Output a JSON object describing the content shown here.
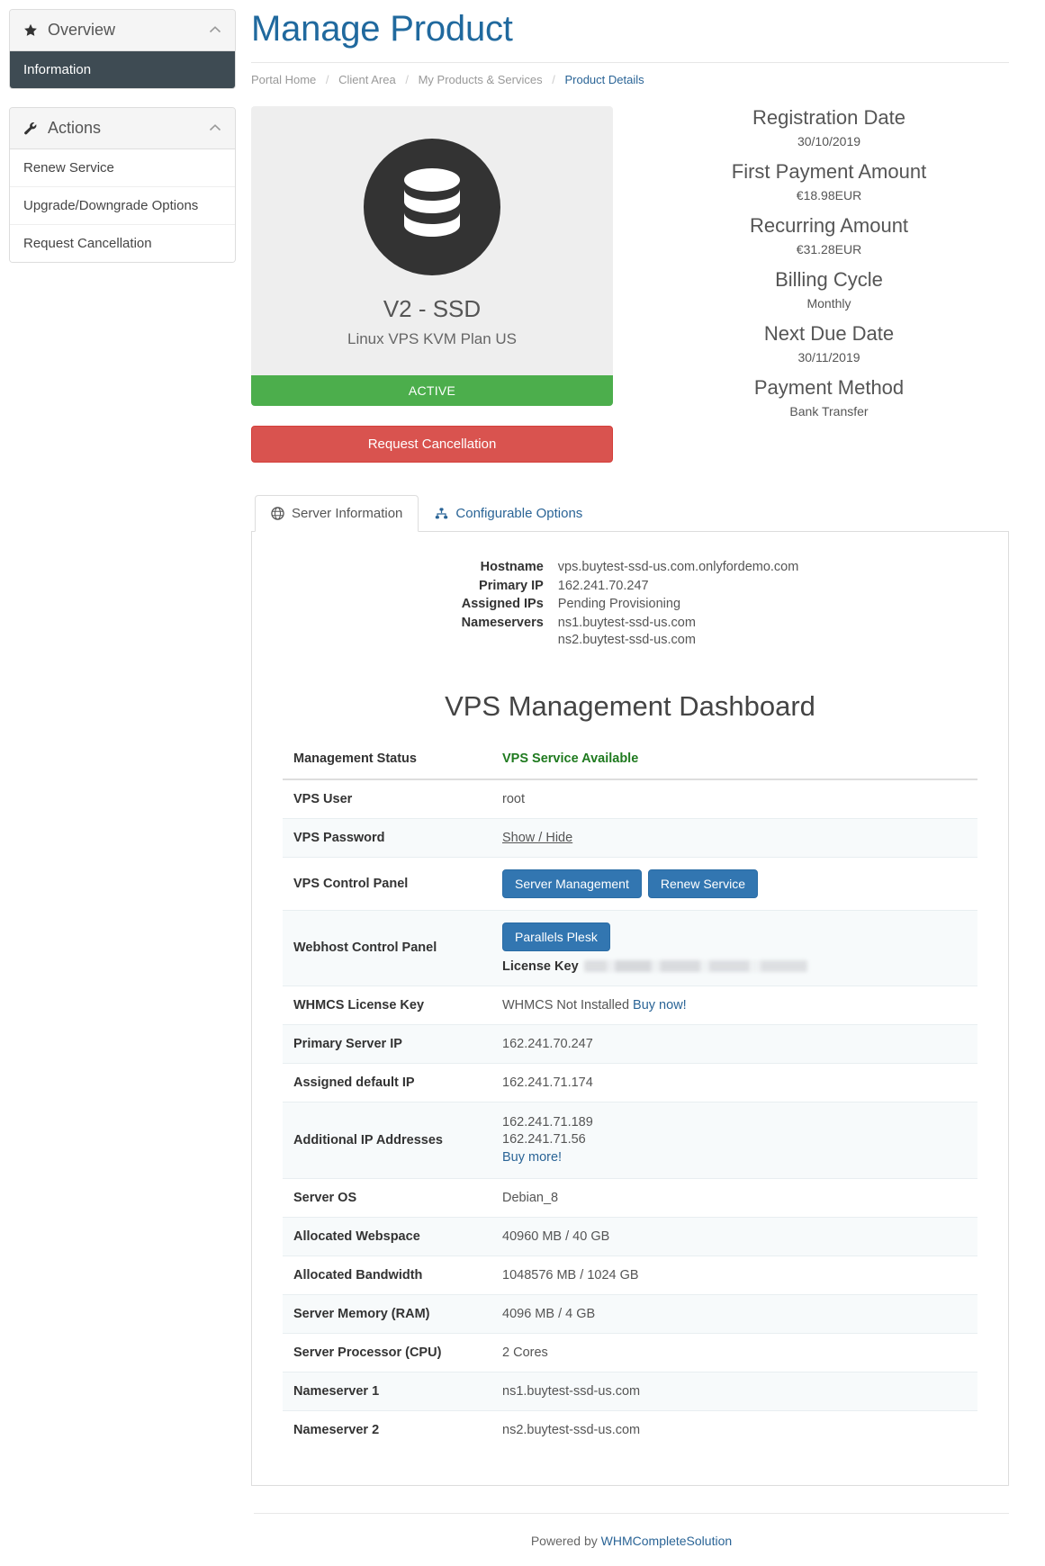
{
  "sidebar": {
    "overview_panel": {
      "title": "Overview",
      "icon": "star-icon",
      "caret": "chevron-up-icon",
      "items": [
        {
          "label": "Information",
          "active": true
        }
      ]
    },
    "actions_panel": {
      "title": "Actions",
      "icon": "wrench-icon",
      "caret": "chevron-up-icon",
      "items": [
        {
          "label": "Renew Service",
          "active": false
        },
        {
          "label": "Upgrade/Downgrade Options",
          "active": false
        },
        {
          "label": "Request Cancellation",
          "active": false
        }
      ]
    }
  },
  "header": {
    "title": "Manage Product",
    "breadcrumb": [
      {
        "label": "Portal Home",
        "current": false
      },
      {
        "label": "Client Area",
        "current": false
      },
      {
        "label": "My Products & Services",
        "current": false
      },
      {
        "label": "Product Details",
        "current": true
      }
    ],
    "separator": "/"
  },
  "product": {
    "icon": "database-icon",
    "name": "V2 - SSD",
    "description": "Linux VPS KVM Plan US",
    "status": "ACTIVE",
    "status_color": "#4cae4c",
    "cancel_button": "Request Cancellation",
    "cancel_color": "#d9534f"
  },
  "billing": [
    {
      "label": "Registration Date",
      "value": "30/10/2019"
    },
    {
      "label": "First Payment Amount",
      "value": "€18.98EUR"
    },
    {
      "label": "Recurring Amount",
      "value": "€31.28EUR"
    },
    {
      "label": "Billing Cycle",
      "value": "Monthly"
    },
    {
      "label": "Next Due Date",
      "value": "30/11/2019"
    },
    {
      "label": "Payment Method",
      "value": "Bank Transfer"
    }
  ],
  "tabs": [
    {
      "label": "Server Information",
      "icon": "globe-icon",
      "active": true
    },
    {
      "label": "Configurable Options",
      "icon": "sitemap-icon",
      "active": false
    }
  ],
  "server_information": [
    {
      "label": "Hostname",
      "value": "vps.buytest-ssd-us.com.onlyfordemo.com"
    },
    {
      "label": "Primary IP",
      "value": "162.241.70.247"
    },
    {
      "label": "Assigned IPs",
      "value": "Pending Provisioning"
    },
    {
      "label": "Nameservers",
      "value": "ns1.buytest-ssd-us.com\nns2.buytest-ssd-us.com"
    }
  ],
  "dashboard": {
    "title": "VPS Management Dashboard",
    "header_key": "Management Status",
    "header_value": "VPS Service Available",
    "header_value_color": "#1f7a1f",
    "rows": {
      "vps_user": {
        "label": "VPS User",
        "value": "root"
      },
      "vps_password": {
        "label": "VPS Password",
        "link": "Show / Hide"
      },
      "vps_control_panel": {
        "label": "VPS Control Panel",
        "buttons": [
          "Server Management",
          "Renew Service"
        ]
      },
      "webhost_control_panel": {
        "label": "Webhost Control Panel",
        "button": "Parallels Plesk",
        "license_label": "License Key",
        "license_value": ""
      },
      "whmcs_license_key": {
        "label": "WHMCS License Key",
        "value": "WHMCS Not Installed",
        "link": "Buy now!"
      },
      "primary_server_ip": {
        "label": "Primary Server IP",
        "value": "162.241.70.247"
      },
      "assigned_default_ip": {
        "label": "Assigned default IP",
        "value": "162.241.71.174"
      },
      "additional_ips": {
        "label": "Additional IP Addresses",
        "values": [
          "162.241.71.189",
          "162.241.71.56"
        ],
        "link": "Buy more!"
      },
      "server_os": {
        "label": "Server OS",
        "value": "Debian_8"
      },
      "allocated_webspace": {
        "label": "Allocated Webspace",
        "value": "40960 MB / 40 GB"
      },
      "allocated_bandwidth": {
        "label": "Allocated Bandwidth",
        "value": "1048576 MB / 1024 GB"
      },
      "server_memory": {
        "label": "Server Memory (RAM)",
        "value": "4096 MB / 4 GB"
      },
      "server_processor": {
        "label": "Server Processor (CPU)",
        "value": "2 Cores"
      },
      "nameserver1": {
        "label": "Nameserver 1",
        "value": "ns1.buytest-ssd-us.com"
      },
      "nameserver2": {
        "label": "Nameserver 2",
        "value": "ns2.buytest-ssd-us.com"
      }
    }
  },
  "footer": {
    "prefix": "Powered by ",
    "link": "WHMCompleteSolution"
  }
}
